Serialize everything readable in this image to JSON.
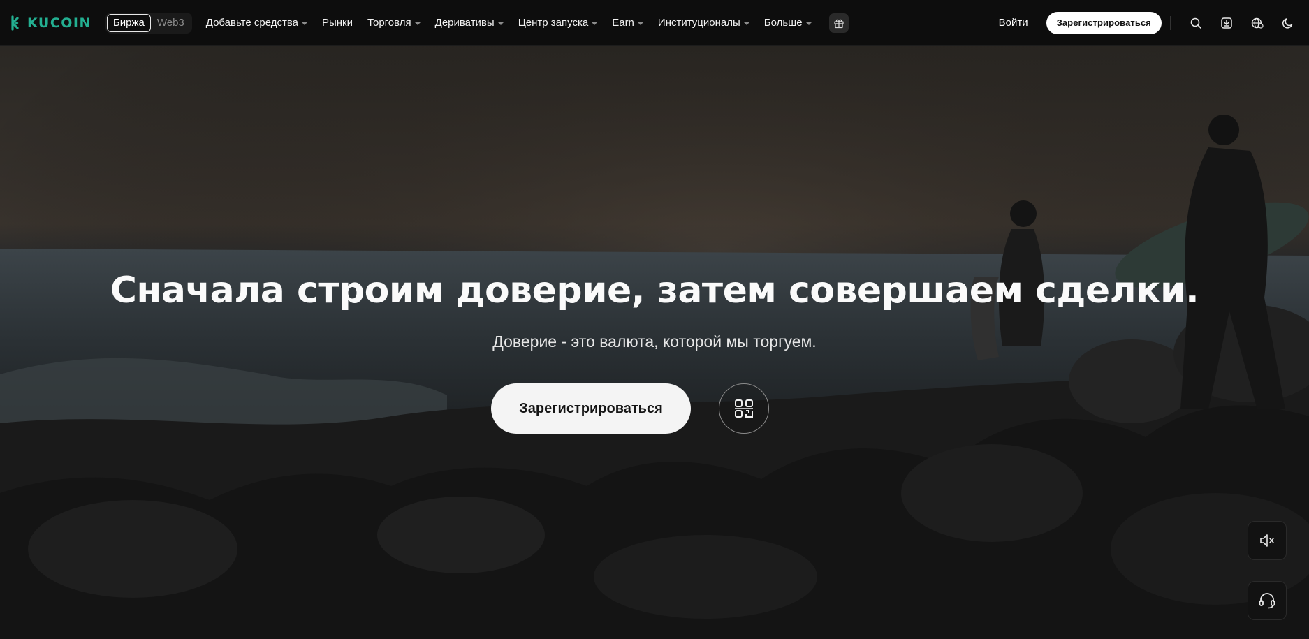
{
  "brand": {
    "name": "KUCOIN",
    "color": "#23af91"
  },
  "switcher": {
    "items": [
      {
        "label": "Биржа",
        "active": true
      },
      {
        "label": "Web3",
        "active": false
      }
    ]
  },
  "nav": {
    "items": [
      {
        "label": "Добавьте средства",
        "dropdown": true
      },
      {
        "label": "Рынки",
        "dropdown": false
      },
      {
        "label": "Торговля",
        "dropdown": true
      },
      {
        "label": "Деривативы",
        "dropdown": true
      },
      {
        "label": "Центр запуска",
        "dropdown": true
      },
      {
        "label": "Earn",
        "dropdown": true
      },
      {
        "label": "Институционалы",
        "dropdown": true
      },
      {
        "label": "Больше",
        "dropdown": true
      }
    ],
    "promo_icon": "gift-icon"
  },
  "header_right": {
    "login_label": "Войти",
    "register_label": "Зарегистрироваться",
    "icons": [
      "search-icon",
      "download-icon",
      "globe-icon",
      "theme-moon-icon"
    ]
  },
  "hero": {
    "title": "Сначала строим доверие, затем совершаем сделки.",
    "subtitle": "Доверие - это валюта, которой мы торгуем.",
    "register_label": "Зарегистрироваться",
    "qr_icon": "qr-code-icon"
  },
  "floating": {
    "mute_icon": "speaker-mute-icon",
    "support_icon": "headset-icon"
  }
}
